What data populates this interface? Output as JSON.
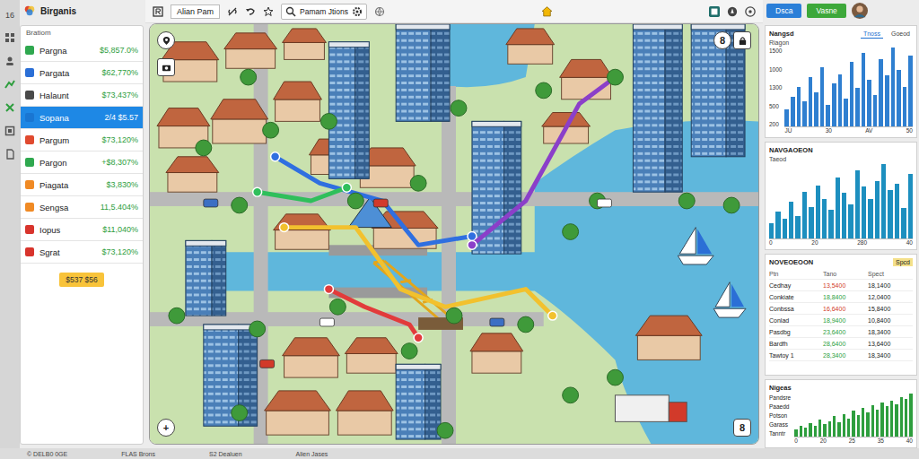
{
  "app": {
    "title": "Birganis",
    "rail_label": "16"
  },
  "sidebar": {
    "caption": "Bratiom",
    "items": [
      {
        "label": "Pargna",
        "value": "$5,857.0%",
        "color": "#2fa84f",
        "selected": false
      },
      {
        "label": "Pargata",
        "value": "$62,770%",
        "color": "#2b6fd6",
        "selected": false
      },
      {
        "label": "Halaunt",
        "value": "$73,437%",
        "color": "#4a4a4a",
        "selected": false
      },
      {
        "label": "Sopana",
        "value": "2/4 $5.57",
        "color": "#1976d2",
        "selected": true
      },
      {
        "label": "Pargum",
        "value": "$73,120%",
        "color": "#e04a2f",
        "selected": false
      },
      {
        "label": "Pargon",
        "value": "+$8,307%",
        "color": "#2fa84f",
        "selected": false
      },
      {
        "label": "Piagata",
        "value": "$3,830%",
        "color": "#f08a24",
        "selected": false
      },
      {
        "label": "Sengsa",
        "value": "11,5.404%",
        "color": "#f08a24",
        "selected": false
      },
      {
        "label": "Iopus",
        "value": "$11,040%",
        "color": "#d8342c",
        "selected": false
      },
      {
        "label": "Sgrat",
        "value": "$73,120%",
        "color": "#d8342c",
        "selected": false
      }
    ],
    "badge": "$537 $56"
  },
  "toolbar": {
    "field": "Alian Pam",
    "search": "Pamam Jtions"
  },
  "map": {
    "zoom": "+",
    "top_badge": "8",
    "bottom_badge": "8"
  },
  "header_buttons": [
    {
      "label": "Dsca",
      "color": "#2b7fd8"
    },
    {
      "label": "Vasne",
      "color": "#3da83a"
    }
  ],
  "trend_panel": {
    "title": "Nangsd",
    "tabs": [
      {
        "label": "Tnoss",
        "selected": true
      },
      {
        "label": "Goeod",
        "selected": false
      }
    ],
    "caption": "Riagon",
    "y_ticks": [
      "1500",
      "1000",
      "1300",
      "500",
      "200"
    ],
    "x_ticks": [
      "JU",
      "30",
      "AV",
      "50"
    ],
    "values": [
      300,
      520,
      700,
      450,
      880,
      600,
      1050,
      380,
      760,
      920,
      500,
      1150,
      680,
      1300,
      820,
      560,
      1200,
      900,
      1400,
      1000,
      700,
      1250
    ]
  },
  "nav_panel": {
    "title": "NAVGAOEON",
    "caption": "Taeod",
    "x_ticks": [
      "0",
      "20",
      "280",
      "40"
    ],
    "values": [
      200,
      350,
      260,
      480,
      300,
      620,
      410,
      700,
      520,
      380,
      800,
      600,
      450,
      900,
      680,
      520,
      760,
      980,
      640,
      720,
      400,
      850
    ]
  },
  "table": {
    "title": "NOVEOEOON",
    "tag": "Spcd",
    "columns": [
      "Ptn",
      "Tano",
      "Spect"
    ],
    "rows": [
      {
        "cells": [
          "Cedhay",
          "13,5400",
          "18,1400"
        ],
        "color": "#d23a2a"
      },
      {
        "cells": [
          "Conkiate",
          "18,8400",
          "12,0400"
        ],
        "color": "#2e9e3e"
      },
      {
        "cells": [
          "Conbssa",
          "16,6400",
          "15,8400"
        ],
        "color": "#d23a2a"
      },
      {
        "cells": [
          "Conlad",
          "18,9400",
          "10,8400"
        ],
        "color": "#2e9e3e"
      },
      {
        "cells": [
          "Pasdbg",
          "23,6400",
          "18,3400"
        ],
        "color": "#2e9e3e"
      },
      {
        "cells": [
          "Bardfh",
          "28,6400",
          "13,6400"
        ],
        "color": "#2e9e3e"
      },
      {
        "cells": [
          "Tawtoy 1",
          "28,3400",
          "18,3400"
        ],
        "color": "#2e9e3e"
      }
    ]
  },
  "mix_panel": {
    "title": "Nigeas",
    "labels": [
      "Pandsre",
      "Paaedd",
      "Potson",
      "Garass",
      "Tanntr"
    ],
    "x_ticks": [
      "0",
      "20",
      "25",
      "35",
      "40"
    ],
    "values": [
      80,
      120,
      100,
      160,
      130,
      200,
      150,
      180,
      240,
      170,
      260,
      210,
      300,
      250,
      330,
      280,
      360,
      310,
      400,
      350,
      420,
      380,
      460,
      440,
      500
    ]
  },
  "status_bar": [
    "© DELB0 0GE",
    "FLAS Brons",
    "S2 Dealuen",
    "Alien Jases"
  ]
}
